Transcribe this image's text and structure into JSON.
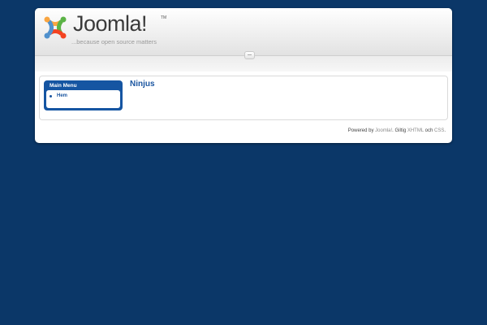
{
  "colors": {
    "page_background": "#0b3768",
    "accent_blue": "#1555a2",
    "link_blue": "#1a55a0"
  },
  "header": {
    "logo_word": "Joomla!",
    "logo_tm": "TM",
    "logo_tagline": "...because open source matters"
  },
  "sidebar": {
    "module_title": "Main Menu",
    "items": [
      {
        "label": "Hem",
        "icon": "bullet-icon"
      }
    ]
  },
  "main": {
    "article_title": "Ninjus"
  },
  "footer": {
    "powered_by": "Powered by ",
    "joomla_link": "Joomla!",
    "valid_text": ". Giltig ",
    "xhtml_link": "XHTML",
    "and_text": " och ",
    "css_link": "CSS",
    "end_text": "."
  }
}
